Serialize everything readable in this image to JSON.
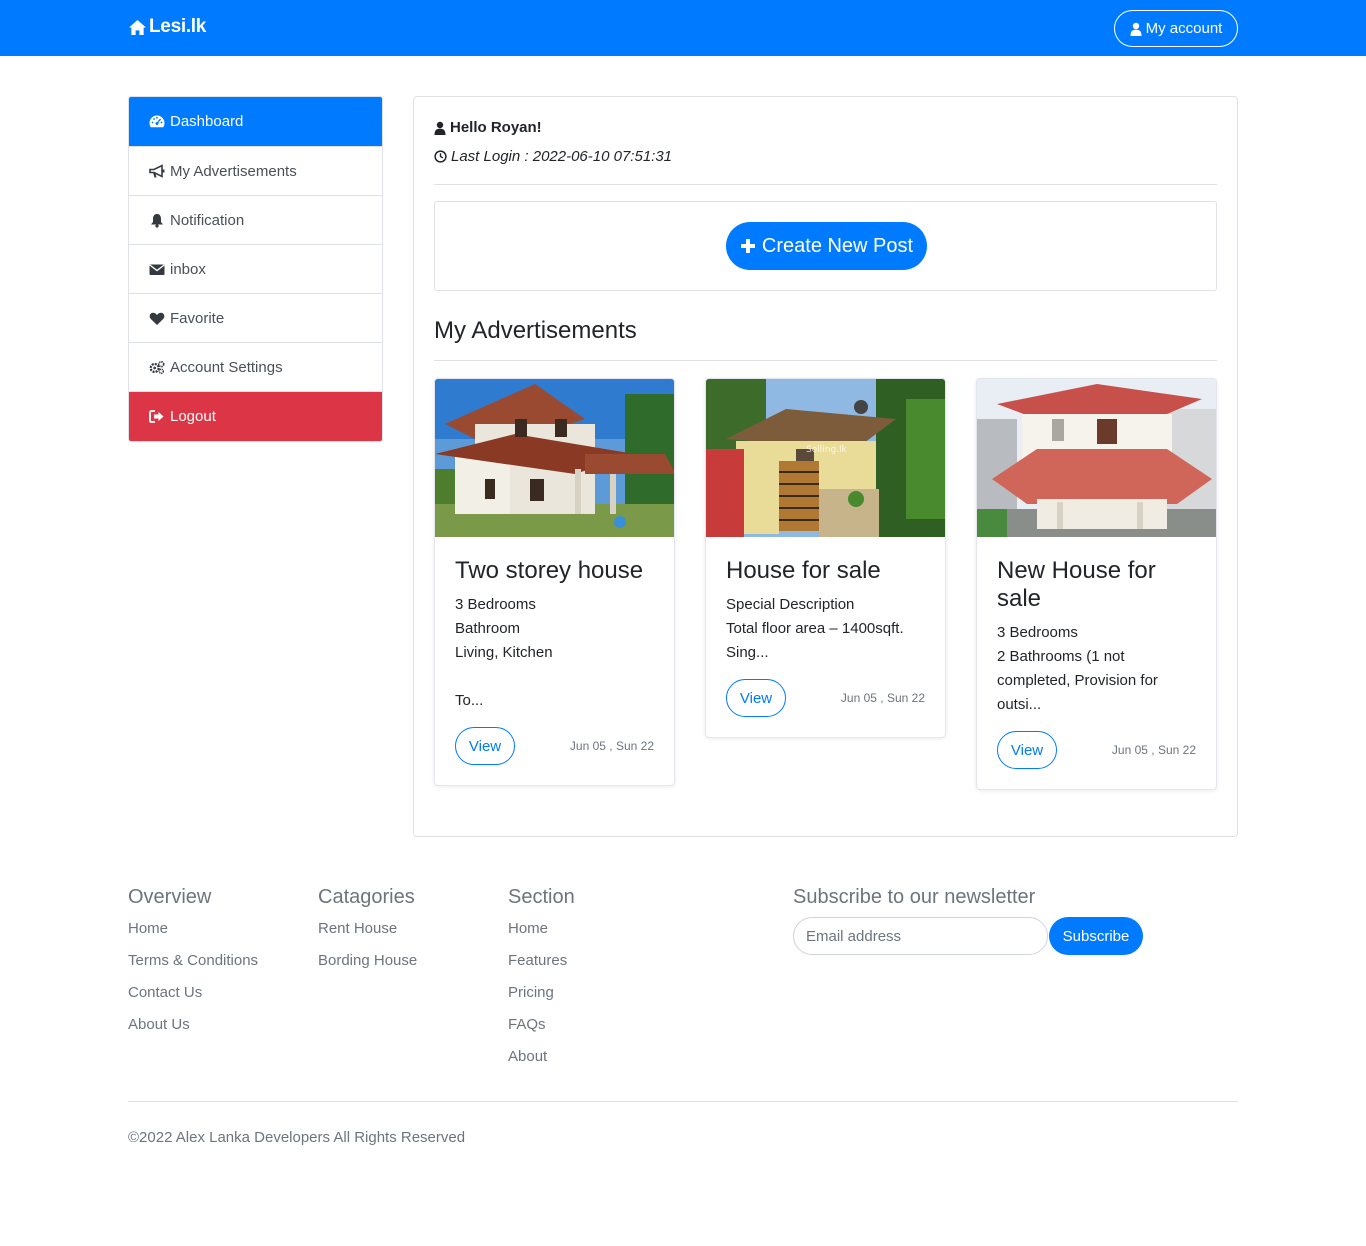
{
  "navbar": {
    "brand": "Lesi.lk",
    "account_label": "My account",
    "bg_color": "#007bff"
  },
  "sidebar": {
    "items": [
      {
        "label": "Dashboard",
        "icon": "dashboard-icon",
        "state": "active"
      },
      {
        "label": "My Advertisements",
        "icon": "bullhorn-icon"
      },
      {
        "label": "Notification",
        "icon": "bell-icon"
      },
      {
        "label": "inbox",
        "icon": "envelope-icon"
      },
      {
        "label": "Favorite",
        "icon": "heart-icon"
      },
      {
        "label": "Account Settings",
        "icon": "gears-icon"
      },
      {
        "label": "Logout",
        "icon": "sign-out-icon",
        "state": "danger"
      }
    ]
  },
  "main": {
    "greeting": "Hello Royan!",
    "last_login": "Last Login : 2022-06-10 07:51:31",
    "create_button": "Create New Post",
    "section_title": "My Advertisements",
    "cards": [
      {
        "title": "Two storey house",
        "text": "3 Bedrooms\nBathroom\nLiving, Kitchen\n\nTo...",
        "button": "View",
        "date": "Jun 05 , Sun 22"
      },
      {
        "title": "House for sale",
        "text": "Special Description\nTotal floor area – 1400sqft.\nSing...",
        "button": "View",
        "date": "Jun 05 , Sun 22",
        "watermark": "Selling.lk"
      },
      {
        "title": "New House for sale",
        "text": "3 Bedrooms\n2 Bathrooms (1 not completed, Provision for outsi...",
        "button": "View",
        "date": "Jun 05 , Sun 22"
      }
    ]
  },
  "footer": {
    "overview": {
      "title": "Overview",
      "links": [
        "Home",
        "Terms & Conditions",
        "Contact Us",
        "About Us"
      ]
    },
    "categories": {
      "title": "Catagories",
      "links": [
        "Rent House",
        "Bording House"
      ]
    },
    "section": {
      "title": "Section",
      "links": [
        "Home",
        "Features",
        "Pricing",
        "FAQs",
        "About"
      ]
    },
    "newsletter": {
      "title": "Subscribe to our newsletter",
      "placeholder": "Email address",
      "button": "Subscribe"
    },
    "copyright": "©2022 Alex Lanka Developers All Rights Reserved"
  }
}
